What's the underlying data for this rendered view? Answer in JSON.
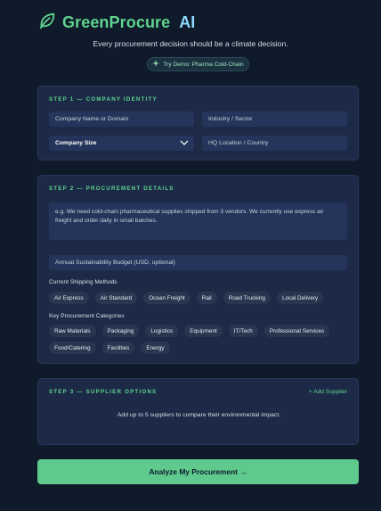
{
  "brand": {
    "name": "GreenProcure",
    "suffix": "AI"
  },
  "tagline": "Every procurement decision should be a climate decision.",
  "demo_button": {
    "label": "Try Demo: Pharma Cold-Chain",
    "icon": "sparkle-icon"
  },
  "step1": {
    "title": "STEP 1 — COMPANY IDENTITY",
    "company_name_placeholder": "Company Name or Domain",
    "industry_placeholder": "Industry / Sector",
    "company_size_value": "Company Size",
    "hq_placeholder": "HQ Location / Country"
  },
  "step2": {
    "title": "STEP 2 — PROCUREMENT DETAILS",
    "description_placeholder": "e.g. We need cold-chain pharmaceutical supplies shipped from 3 vendors. We currently use express air freight and order daily in small batches.",
    "budget_placeholder": "Annual Sustainability Budget (USD, optional)",
    "shipping_label": "Current Shipping Methods",
    "shipping_methods": [
      "Air Express",
      "Air Standard",
      "Ocean Freight",
      "Rail",
      "Road Trucking",
      "Local Delivery"
    ],
    "categories_label": "Key Procurement Categories",
    "categories": [
      "Raw Materials",
      "Packaging",
      "Logistics",
      "Equipment",
      "IT/Tech",
      "Professional Services",
      "Food/Catering",
      "Facilities",
      "Energy"
    ]
  },
  "step3": {
    "title": "STEP 3 — SUPPLIER OPTIONS",
    "add_label": "+ Add Supplier",
    "hint": "Add up to 5 suppliers to compare their environmental impact."
  },
  "analyze_button": {
    "label": "Analyze My Procurement →"
  },
  "colors": {
    "accent": "#5fd38d",
    "ai_accent": "#8fd8ff",
    "background": "#0f1a2b",
    "card": "#1c2a47",
    "field": "#25345a"
  }
}
